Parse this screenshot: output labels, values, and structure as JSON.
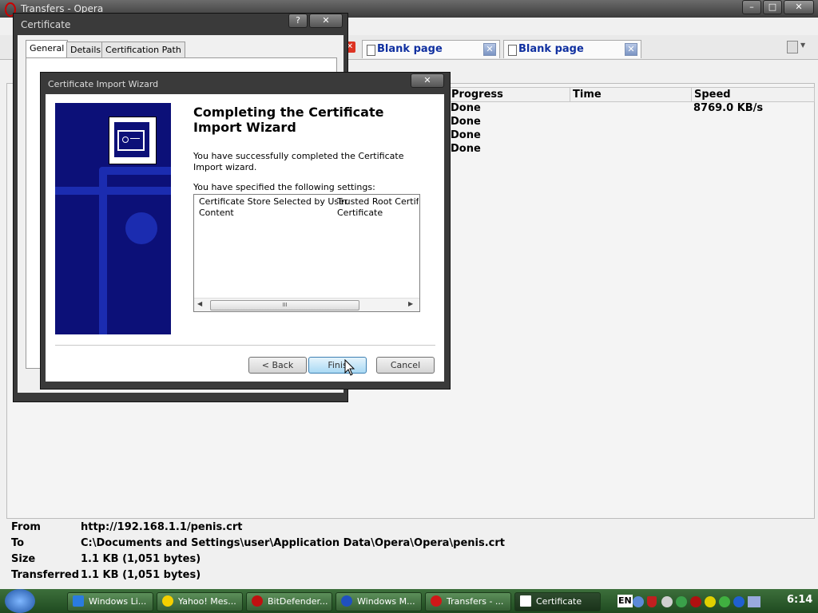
{
  "opera": {
    "title": "Transfers - Opera",
    "tabs": [
      {
        "label": "Blank page"
      },
      {
        "label": "Blank page"
      }
    ],
    "columns": [
      "Progress",
      "Time",
      "Speed"
    ],
    "rows": [
      {
        "progress": "Done",
        "time": "",
        "speed": "8769.0 KB/s"
      },
      {
        "progress": "Done",
        "time": "",
        "speed": ""
      },
      {
        "progress": "Done",
        "time": "",
        "speed": ""
      },
      {
        "progress": "Done",
        "time": "",
        "speed": ""
      }
    ],
    "details": {
      "from_label": "From",
      "from": "http://192.168.1.1/penis.crt",
      "to_label": "To",
      "to": "C:\\Documents and Settings\\user\\Application Data\\Opera\\Opera\\penis.crt",
      "size_label": "Size",
      "size": "1.1 KB (1,051 bytes)",
      "transferred_label": "Transferred",
      "transferred": "1.1 KB (1,051 bytes)"
    }
  },
  "certificate": {
    "title": "Certificate",
    "tabs": [
      "General",
      "Details",
      "Certification Path"
    ]
  },
  "wizard": {
    "title": "Certificate Import Wizard",
    "heading": "Completing the Certificate Import Wizard",
    "success_text": "You have successfully completed the Certificate Import wizard.",
    "settings_intro": "You have specified the following settings:",
    "settings": [
      {
        "key": "Certificate Store Selected by User",
        "value": "Trusted Root Certifica"
      },
      {
        "key": "Content",
        "value": "Certificate"
      }
    ],
    "scroll_grip": "III",
    "back": "< Back",
    "finish": "Finis",
    "cancel": "Cancel"
  },
  "taskbar": {
    "items": [
      "Windows Li...",
      "Yahoo! Mes...",
      "BitDefender...",
      "Windows M...",
      "Transfers - ...",
      "Certificate"
    ],
    "lang": "EN",
    "clock": "6:14"
  },
  "colors": {
    "banner": "#0c1078",
    "taskbar": "#2d5f2c",
    "tab_text": "#1030a0"
  }
}
